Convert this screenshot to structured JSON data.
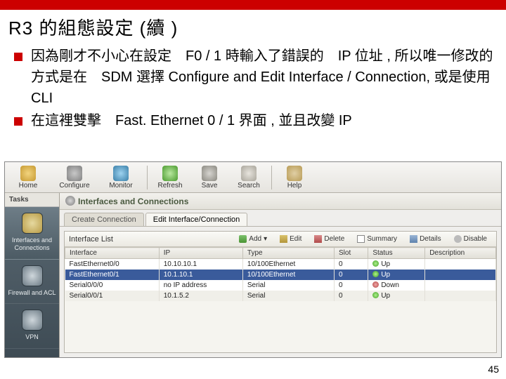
{
  "colors": {
    "accent": "#c00"
  },
  "title": "R3 的組態設定  (續 )",
  "bullets": [
    "因為剛才不小心在設定　F0 / 1 時輸入了錯誤的　IP 位址 , 所以唯一修改的方式是在　SDM 選擇 Configure and Edit Interface / Connection, 或是使用 CLI",
    "在這裡雙擊　Fast. Ethernet 0 / 1 界面 , 並且改變  IP"
  ],
  "toolbar": {
    "home": "Home",
    "configure": "Configure",
    "monitor": "Monitor",
    "refresh": "Refresh",
    "save": "Save",
    "search": "Search",
    "help": "Help"
  },
  "tasks": {
    "header": "Tasks",
    "items": [
      {
        "label": "Interfaces and Connections"
      },
      {
        "label": "Firewall and ACL"
      },
      {
        "label": "VPN"
      }
    ]
  },
  "main": {
    "title": "Interfaces and Connections",
    "tabs": [
      "Create Connection",
      "Edit Interface/Connection"
    ],
    "active_tab": 1,
    "list_label": "Interface List",
    "actions": {
      "add": "Add",
      "edit": "Edit",
      "delete": "Delete",
      "summary": "Summary",
      "details": "Details",
      "disable": "Disable"
    },
    "columns": [
      "Interface",
      "IP",
      "Type",
      "Slot",
      "Status",
      "Description"
    ],
    "rows": [
      {
        "iface": "FastEthernet0/0",
        "ip": "10.10.10.1",
        "type": "10/100Ethernet",
        "slot": "0",
        "status": "Up",
        "desc": ""
      },
      {
        "iface": "FastEthernet0/1",
        "ip": "10.1.10.1",
        "type": "10/100Ethernet",
        "slot": "0",
        "status": "Up",
        "desc": ""
      },
      {
        "iface": "Serial0/0/0",
        "ip": "no IP address",
        "type": "Serial",
        "slot": "0",
        "status": "Down",
        "desc": ""
      },
      {
        "iface": "Serial0/0/1",
        "ip": "10.1.5.2",
        "type": "Serial",
        "slot": "0",
        "status": "Up",
        "desc": ""
      }
    ],
    "selected_row": 1
  },
  "page_number": "45"
}
